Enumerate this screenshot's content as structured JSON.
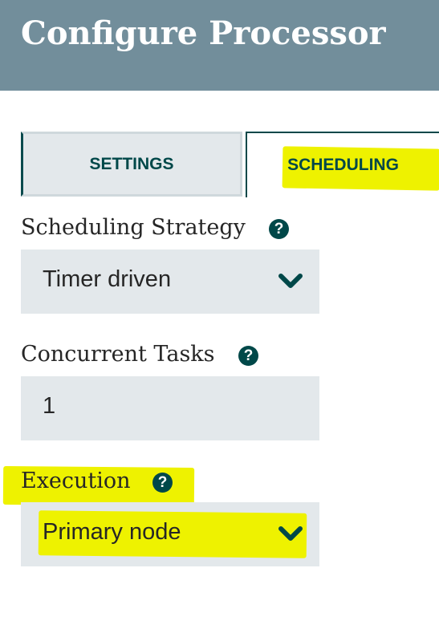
{
  "dialog": {
    "title": "Configure Processor"
  },
  "tabs": [
    {
      "label": "SETTINGS",
      "active": false
    },
    {
      "label": "SCHEDULING",
      "active": true
    }
  ],
  "fields": {
    "scheduling_strategy": {
      "label": "Scheduling Strategy",
      "help": "?",
      "value": "Timer driven",
      "icon": "chevron-down-icon"
    },
    "concurrent_tasks": {
      "label": "Concurrent Tasks",
      "help": "?",
      "value": "1"
    },
    "execution": {
      "label": "Execution",
      "help": "?",
      "value": "Primary node",
      "icon": "chevron-down-icon"
    }
  },
  "colors": {
    "header_bg": "#728e9b",
    "accent": "#004849",
    "field_bg": "#e3e8eb",
    "highlight": "#eef200"
  }
}
